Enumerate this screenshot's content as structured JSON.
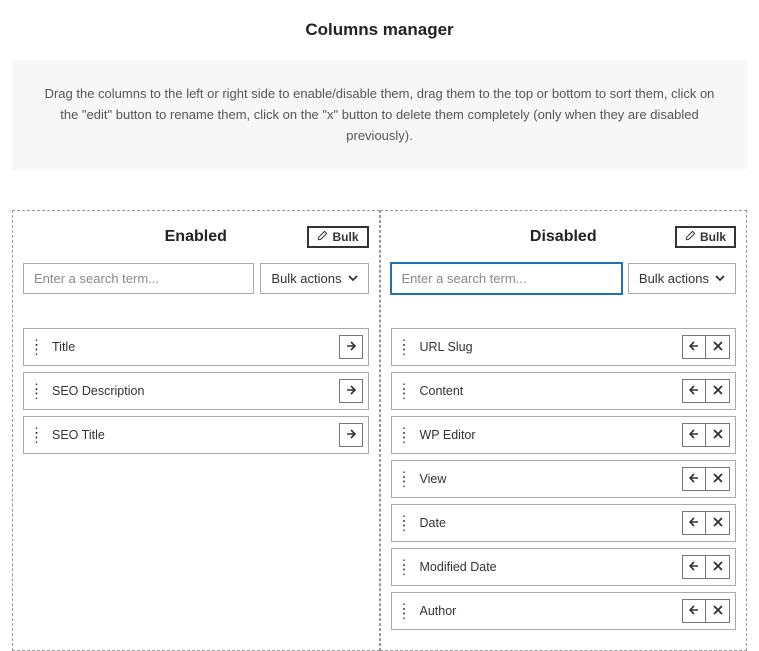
{
  "title": "Columns manager",
  "instructions": "Drag the columns to the left or right side to enable/disable them, drag them to the top or bottom to sort them, click on the \"edit\" button to rename them, click on the \"x\" button to delete them completely (only when they are disabled previously).",
  "bulk_button_label": "Bulk",
  "bulk_actions_label": "Bulk actions",
  "search_placeholder": "Enter a search term...",
  "enabled": {
    "title": "Enabled",
    "items": [
      {
        "label": "Title"
      },
      {
        "label": "SEO Description"
      },
      {
        "label": "SEO Title"
      }
    ]
  },
  "disabled": {
    "title": "Disabled",
    "items": [
      {
        "label": "URL Slug"
      },
      {
        "label": "Content"
      },
      {
        "label": "WP Editor"
      },
      {
        "label": "View"
      },
      {
        "label": "Date"
      },
      {
        "label": "Modified Date"
      },
      {
        "label": "Author"
      }
    ]
  }
}
